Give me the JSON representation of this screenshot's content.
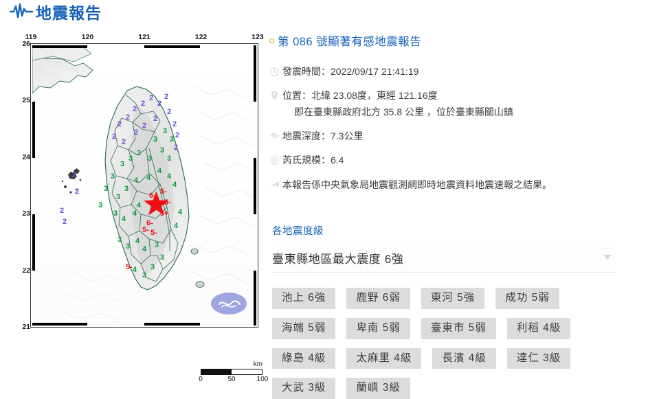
{
  "header": {
    "title": "地震報告",
    "icon": "seismograph-wave-icon"
  },
  "report": {
    "title": "第 086 號顯著有感地震報告",
    "bullet_color": "#f0a030",
    "title_color": "#1763b8",
    "rows": [
      {
        "icon": "clock-icon",
        "label": "發震時間：",
        "value": "2022/09/17 21:41:19"
      },
      {
        "icon": "map-pin-icon",
        "label": "位置：",
        "value": "北緯 23.08度，東經 121.16度",
        "sub": "即在臺東縣政府北方 35.8 公里 ，位於臺東縣關山鎮"
      },
      {
        "icon": "seismograph-icon",
        "label": "地震深度：",
        "value": "7.3公里"
      },
      {
        "icon": "magnitude-icon",
        "label": "芮氏規模：",
        "value": "6.4"
      },
      {
        "icon": "megaphone-icon",
        "label": "",
        "value": "本報告係中央氣象局地震觀測網即時地震資料地震速報之結果。"
      }
    ]
  },
  "intensity": {
    "section_label": "各地震度級",
    "selected": "臺東縣地區最大震度 6強",
    "badges": [
      "池上 6強",
      "鹿野 6弱",
      "東河 5強",
      "成功 5弱",
      "海端 5弱",
      "卑南 5弱",
      "臺東市 5弱",
      "利稻 4級",
      "綠島 4級",
      "太麻里 4級",
      "長濱 4級",
      "達仁 3級",
      "大武 3級",
      "蘭嶼 3級"
    ]
  },
  "map": {
    "x_ticks": [
      "119",
      "120",
      "121",
      "122",
      "123"
    ],
    "y_ticks": [
      "26",
      "25",
      "24",
      "23",
      "22",
      "21"
    ],
    "scale": {
      "unit": "km",
      "labels": [
        "0",
        "50",
        "100"
      ]
    },
    "epicenter": {
      "lat": 23.08,
      "lon": 121.16
    },
    "colors": {
      "intensity_red": "#ee1111",
      "intensity_green": "#0a9b3c",
      "intensity_purple": "#6a4fd8",
      "coastline": "#2e6b52",
      "terrain": "#d9d9d9"
    },
    "station_markers": [
      {
        "label": "6-",
        "lon": 121.08,
        "lat": 23.22,
        "color": "#ee1111"
      },
      {
        "label": "5+",
        "lon": 121.22,
        "lat": 23.2,
        "color": "#ee1111"
      },
      {
        "label": "5-",
        "lon": 121.3,
        "lat": 23.12,
        "color": "#ee1111"
      },
      {
        "label": "5+",
        "lon": 121.24,
        "lat": 22.98,
        "color": "#ee1111"
      },
      {
        "label": "6-",
        "lon": 121.04,
        "lat": 22.88,
        "color": "#ee1111"
      },
      {
        "label": "5-",
        "lon": 121.1,
        "lat": 22.76,
        "color": "#ee1111"
      },
      {
        "label": "5-",
        "lon": 120.78,
        "lat": 22.3,
        "color": "#ee1111"
      },
      {
        "label": "4",
        "lon": 121.4,
        "lat": 23.42,
        "color": "#0a9b3c"
      },
      {
        "label": "4",
        "lon": 121.18,
        "lat": 23.56,
        "color": "#0a9b3c"
      },
      {
        "label": "4",
        "lon": 121.52,
        "lat": 22.8,
        "color": "#0a9b3c"
      },
      {
        "label": "3",
        "lon": 120.62,
        "lat": 22.7,
        "color": "#0a9b3c"
      },
      {
        "label": "3",
        "lon": 120.4,
        "lat": 23.1,
        "color": "#0a9b3c"
      },
      {
        "label": "4",
        "lon": 120.58,
        "lat": 23.4,
        "color": "#0a9b3c"
      },
      {
        "label": "3",
        "lon": 120.3,
        "lat": 23.7,
        "color": "#0a9b3c"
      },
      {
        "label": "3",
        "lon": 120.9,
        "lat": 24.0,
        "color": "#0a9b3c"
      },
      {
        "label": "2",
        "lon": 121.5,
        "lat": 25.1,
        "color": "#6a4fd8"
      },
      {
        "label": "2",
        "lon": 121.2,
        "lat": 25.0,
        "color": "#6a4fd8"
      },
      {
        "label": "2",
        "lon": 120.7,
        "lat": 24.6,
        "color": "#6a4fd8"
      },
      {
        "label": "2",
        "lon": 119.6,
        "lat": 23.6,
        "color": "#6a4fd8"
      },
      {
        "label": "2",
        "lon": 119.5,
        "lat": 23.4,
        "color": "#6a4fd8"
      }
    ]
  }
}
